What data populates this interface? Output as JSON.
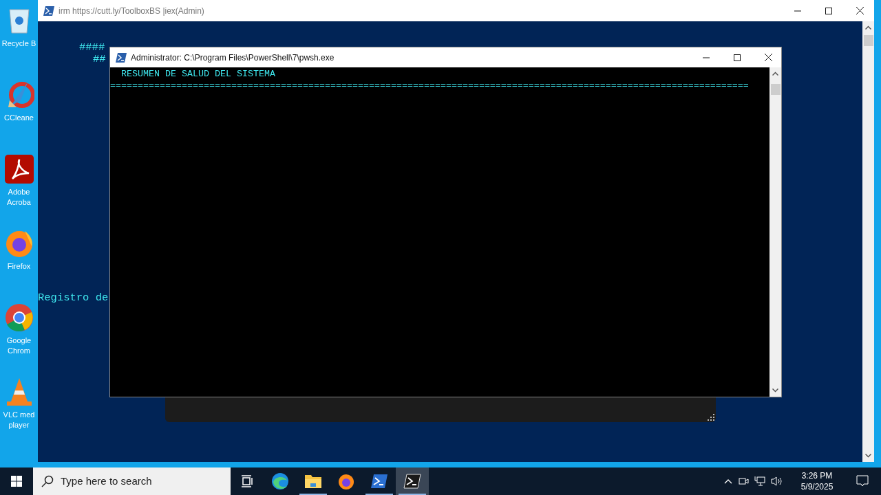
{
  "desktop_icons": [
    {
      "kind": "recycle",
      "label_lines": [
        "Recycle B"
      ]
    },
    {
      "kind": "ccleaner",
      "label_lines": [
        "CCleane"
      ]
    },
    {
      "kind": "acrobat",
      "label_lines": [
        "Adobe",
        "Acroba"
      ]
    },
    {
      "kind": "firefox",
      "label_lines": [
        "Firefox"
      ]
    },
    {
      "kind": "chrome",
      "label_lines": [
        "Google",
        "Chrom"
      ]
    },
    {
      "kind": "vlc",
      "label_lines": [
        "VLC med",
        "player"
      ]
    }
  ],
  "back_window": {
    "title": "irm https://cutt.ly/ToolboxBS |iex(Admin)",
    "banner_lines": [
      "####",
      "##"
    ],
    "log_line": "Registro de"
  },
  "front_window": {
    "title": "Administrator: C:\\Program Files\\PowerShell\\7\\pwsh.exe",
    "lines": [
      "  RESUMEN DE SALUD DEL SISTEMA",
      "===================================================================================================================="
    ]
  },
  "taskbar": {
    "search": {
      "placeholder": "Type here to search"
    },
    "apps": [
      {
        "kind": "taskview",
        "running": false,
        "selected": false
      },
      {
        "kind": "edge",
        "running": false,
        "selected": false
      },
      {
        "kind": "explorer",
        "running": true,
        "selected": false
      },
      {
        "kind": "firefox",
        "running": false,
        "selected": false
      },
      {
        "kind": "powershell",
        "running": true,
        "selected": false
      },
      {
        "kind": "terminal",
        "running": true,
        "selected": true
      }
    ],
    "time": "3:26 PM",
    "date": "5/9/2025"
  }
}
